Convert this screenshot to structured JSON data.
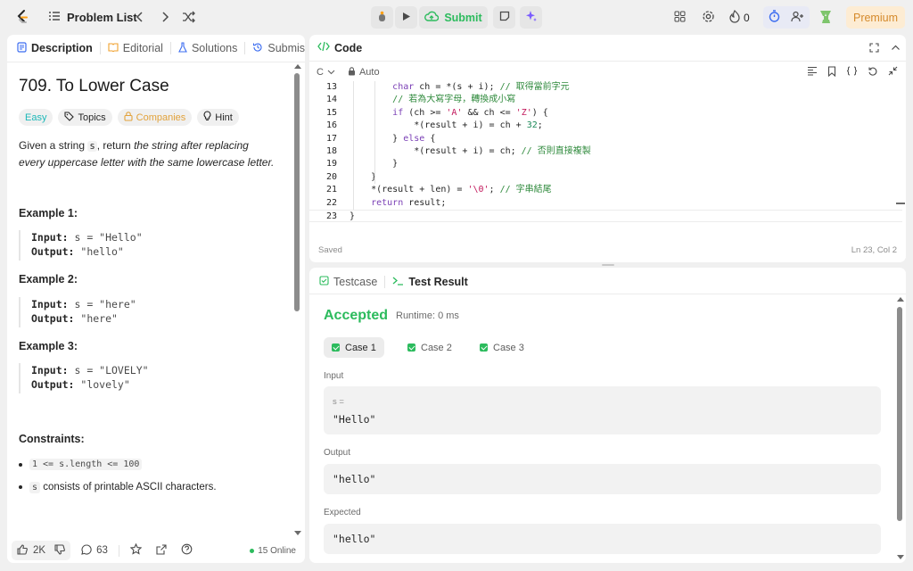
{
  "topbar": {
    "problem_list": "Problem List",
    "submit": "Submit",
    "streak": "0",
    "premium": "Premium"
  },
  "left": {
    "tabs": [
      "Description",
      "Editorial",
      "Solutions",
      "Submissions"
    ],
    "title": "709. To Lower Case",
    "tags": {
      "difficulty": "Easy",
      "topics": "Topics",
      "companies": "Companies",
      "hint": "Hint"
    },
    "desc": {
      "p1": "Given a string ",
      "code": "s",
      "p2": ", return ",
      "em": "the string after replacing every uppercase letter with the same lowercase letter."
    },
    "examples": [
      {
        "title": "Example 1:",
        "input_label": "Input:",
        "input": " s = \"Hello\"",
        "output_label": "Output:",
        "output": " \"hello\""
      },
      {
        "title": "Example 2:",
        "input_label": "Input:",
        "input": " s = \"here\"",
        "output_label": "Output:",
        "output": " \"here\""
      },
      {
        "title": "Example 3:",
        "input_label": "Input:",
        "input": " s = \"LOVELY\"",
        "output_label": "Output:",
        "output": " \"lovely\""
      }
    ],
    "constraints_title": "Constraints:",
    "constraints": {
      "c1": "1 <= s.length <= 100",
      "c2_code": "s",
      "c2_text": " consists of printable ASCII characters."
    },
    "footer": {
      "likes": "2K",
      "comments": "63",
      "online": "15 Online"
    }
  },
  "code_panel": {
    "title": "Code",
    "lang": "C",
    "mode": "Auto",
    "saved": "Saved",
    "cursor": "Ln 23, Col 2",
    "lines": [
      {
        "n": "13",
        "t": "        char ch = *(s + i); // 取得當前字元"
      },
      {
        "n": "14",
        "t": "        // 若為大寫字母，轉換成小寫"
      },
      {
        "n": "15",
        "t": "        if (ch >= 'A' && ch <= 'Z') {"
      },
      {
        "n": "16",
        "t": "            *(result + i) = ch + 32;"
      },
      {
        "n": "17",
        "t": "        } else {"
      },
      {
        "n": "18",
        "t": "            *(result + i) = ch; // 否則直接複製"
      },
      {
        "n": "19",
        "t": "        }"
      },
      {
        "n": "20",
        "t": "    }"
      },
      {
        "n": "21",
        "t": "    *(result + len) = '\\0'; // 字串結尾"
      },
      {
        "n": "22",
        "t": "    return result;"
      },
      {
        "n": "23",
        "t": "}"
      }
    ]
  },
  "result_panel": {
    "tabs": [
      "Testcase",
      "Test Result"
    ],
    "status": "Accepted",
    "runtime": "Runtime: 0 ms",
    "cases": [
      "Case 1",
      "Case 2",
      "Case 3"
    ],
    "input_label": "Input",
    "var_label": "s =",
    "input_value": "\"Hello\"",
    "output_label": "Output",
    "output_value": "\"hello\"",
    "expected_label": "Expected",
    "expected_value": "\"hello\""
  },
  "colors": {
    "accent": "#2cbb5d",
    "easy": "#1cb8b8",
    "premium_bg": "#fdecd3",
    "premium_text": "#d58a2b"
  }
}
